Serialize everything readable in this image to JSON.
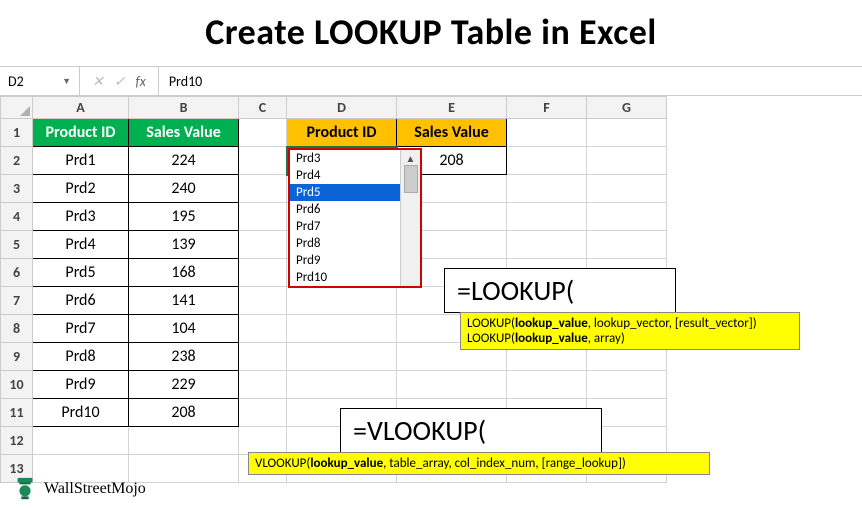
{
  "title": "Create LOOKUP Table in Excel",
  "nameBox": "D2",
  "formulaBarValue": "Prd10",
  "columns": [
    "A",
    "B",
    "C",
    "D",
    "E",
    "F",
    "G"
  ],
  "rows": [
    "1",
    "2",
    "3",
    "4",
    "5",
    "6",
    "7",
    "8",
    "9",
    "10",
    "11",
    "12",
    "13"
  ],
  "widths": {
    "A": 96,
    "B": 110,
    "C": 48,
    "D": 110,
    "E": 110,
    "F": 80,
    "G": 80
  },
  "headersAB": {
    "A": "Product ID",
    "B": "Sales Value"
  },
  "headersDE": {
    "D": "Product ID",
    "E": "Sales Value"
  },
  "dataAB": [
    {
      "A": "Prd1",
      "B": "224"
    },
    {
      "A": "Prd2",
      "B": "240"
    },
    {
      "A": "Prd3",
      "B": "195"
    },
    {
      "A": "Prd4",
      "B": "139"
    },
    {
      "A": "Prd5",
      "B": "168"
    },
    {
      "A": "Prd6",
      "B": "141"
    },
    {
      "A": "Prd7",
      "B": "104"
    },
    {
      "A": "Prd8",
      "B": "238"
    },
    {
      "A": "Prd9",
      "B": "229"
    },
    {
      "A": "Prd10",
      "B": "208"
    }
  ],
  "d2": "Prd10",
  "e2": "208",
  "dropdown": {
    "items": [
      "Prd3",
      "Prd4",
      "Prd5",
      "Prd6",
      "Prd7",
      "Prd8",
      "Prd9",
      "Prd10"
    ],
    "selectedIndex": 2
  },
  "lookupFormula": "=LOOKUP(",
  "lookupTip1_a": "LOOKUP(",
  "lookupTip1_b": "lookup_value",
  "lookupTip1_c": ", lookup_vector, [result_vector])",
  "lookupTip2_a": "LOOKUP(",
  "lookupTip2_b": "lookup_value",
  "lookupTip2_c": ", array)",
  "vlookupFormula": "=VLOOKUP(",
  "vlookupTip_a": "VLOOKUP(",
  "vlookupTip_b": "lookup_value",
  "vlookupTip_c": ", table_array, col_index_num, [range_lookup])",
  "logoText": "WallStreetMojo"
}
